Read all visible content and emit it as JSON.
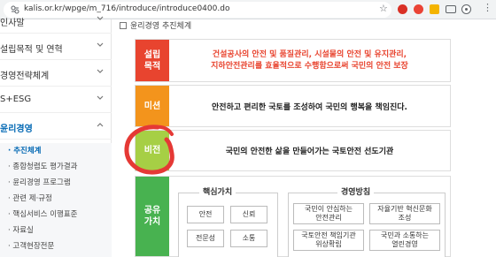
{
  "browser": {
    "url": "kalis.or.kr/wpge/m_716/introduce/introduce0400.do"
  },
  "sidebar": {
    "items": [
      {
        "label": "인사말"
      },
      {
        "label": "설립목적 및 연혁"
      },
      {
        "label": "경영전략체계"
      },
      {
        "label": "S+ESG"
      },
      {
        "label": "윤리경영"
      }
    ],
    "submenu": [
      {
        "label": "· 추진체계"
      },
      {
        "label": "· 종합청렴도 평가결과"
      },
      {
        "label": "· 윤리경영 프로그램"
      },
      {
        "label": "· 관련 제·규정"
      },
      {
        "label": "· 핵심서비스 이행표준"
      },
      {
        "label": "· 자료실"
      },
      {
        "label": "· 고객현장전문"
      }
    ]
  },
  "content": {
    "breadcrumb": "윤리경영 추진체계",
    "rows": [
      {
        "tag": "설립\n목적",
        "text": "건설공사의 안전 및 품질관리, 시설물의 안전 및 유지관리,\n지하안전관리를 효율적으로 수행함으로써 국민의 안전 보장"
      },
      {
        "tag": "미션",
        "text": "안전하고 편리한 국토를 조성하여 국민의 행복을 책임진다."
      },
      {
        "tag": "비전",
        "text": "국민의 안전한 삶을 만들어가는 국토안전 선도기관"
      },
      {
        "tag": "공유\n가치",
        "text": ""
      }
    ],
    "core_values": {
      "title": "핵심가치",
      "items": [
        "안전",
        "신뢰",
        "전문성",
        "소통"
      ]
    },
    "policies": {
      "title": "경영방침",
      "items": [
        "국민이 안심하는\n안전관리",
        "자율기반 혁신문화\n조성",
        "국토안전 책임기관\n위상확립",
        "국민과 소통하는\n열린경영"
      ]
    }
  },
  "colors": {
    "purpose": "#e8442f",
    "mission": "#f3941c",
    "vision": "#a6cf45",
    "shared_values": "#48b250",
    "active_menu": "#0067b3",
    "annotation": "#e53935"
  }
}
